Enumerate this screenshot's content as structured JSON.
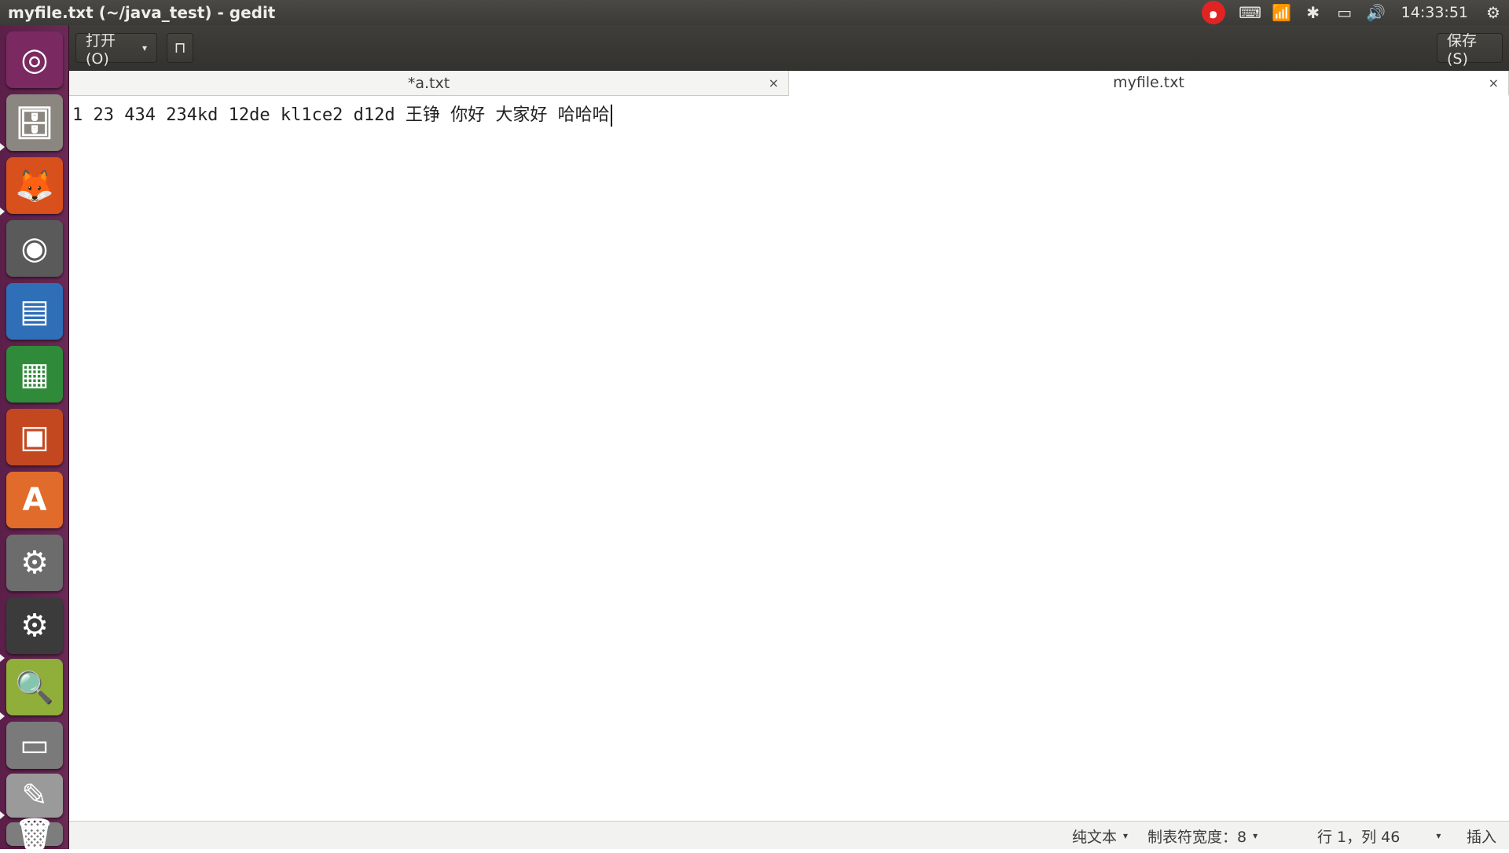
{
  "window": {
    "title": "myfile.txt (~/java_test) - gedit"
  },
  "top_panel": {
    "indicators": [
      {
        "name": "netease-music-icon",
        "glyph": "๑"
      },
      {
        "name": "keyboard-icon",
        "glyph": "⌨"
      },
      {
        "name": "wifi-icon",
        "glyph": "📶"
      },
      {
        "name": "bluetooth-icon",
        "glyph": "✱"
      },
      {
        "name": "battery-icon",
        "glyph": "▭"
      },
      {
        "name": "volume-icon",
        "glyph": "🔊"
      }
    ],
    "clock": "14:33:51",
    "settings_glyph": "⚙"
  },
  "launcher": {
    "items": [
      {
        "name": "ubuntu-dash-icon",
        "glyph": "◎",
        "bg": "#7a2a60"
      },
      {
        "name": "files-icon",
        "glyph": "🗄",
        "bg": "#8b8680"
      },
      {
        "name": "firefox-icon",
        "glyph": "🦊",
        "bg": "#d8501c"
      },
      {
        "name": "eye-app-icon",
        "glyph": "◉",
        "bg": "#5a5a5a"
      },
      {
        "name": "libreoffice-writer-icon",
        "glyph": "▤",
        "bg": "#2f6fb8"
      },
      {
        "name": "libreoffice-calc-icon",
        "glyph": "▦",
        "bg": "#2f8a3a"
      },
      {
        "name": "libreoffice-impress-icon",
        "glyph": "▣",
        "bg": "#c4481f"
      },
      {
        "name": "software-center-icon",
        "glyph": "A",
        "bg": "#e06b2a"
      },
      {
        "name": "system-settings-icon",
        "glyph": "⚙",
        "bg": "#6c6c6c"
      },
      {
        "name": "eclipse-javaee-icon",
        "glyph": "⚙",
        "bg": "#3b3b3b"
      },
      {
        "name": "image-viewer-icon",
        "glyph": "🔍",
        "bg": "#8fae3a"
      },
      {
        "name": "stacked-windows-icon",
        "glyph": "▭",
        "bg": "#7a7a7a"
      },
      {
        "name": "text-editor-icon",
        "glyph": "✎",
        "bg": "#9a9a9a"
      },
      {
        "name": "trash-icon",
        "glyph": "🗑",
        "bg": "#7d7d7d"
      }
    ]
  },
  "headerbar": {
    "open_label": "打开(O)",
    "pin_glyph": "⊓",
    "save_label": "保存(S)"
  },
  "tabs": [
    {
      "label": "*a.txt",
      "close": "×"
    },
    {
      "label": "myfile.txt",
      "close": "×"
    }
  ],
  "editor": {
    "text": "1 23 434 234kd 12de kl1ce2 d12d 王铮 你好 大家好 哈哈哈"
  },
  "statusbar": {
    "language": "纯文本",
    "tab_width": "制表符宽度：8",
    "position": "行 1，列 46",
    "mode": "插入",
    "caret_glyph": "▾"
  }
}
